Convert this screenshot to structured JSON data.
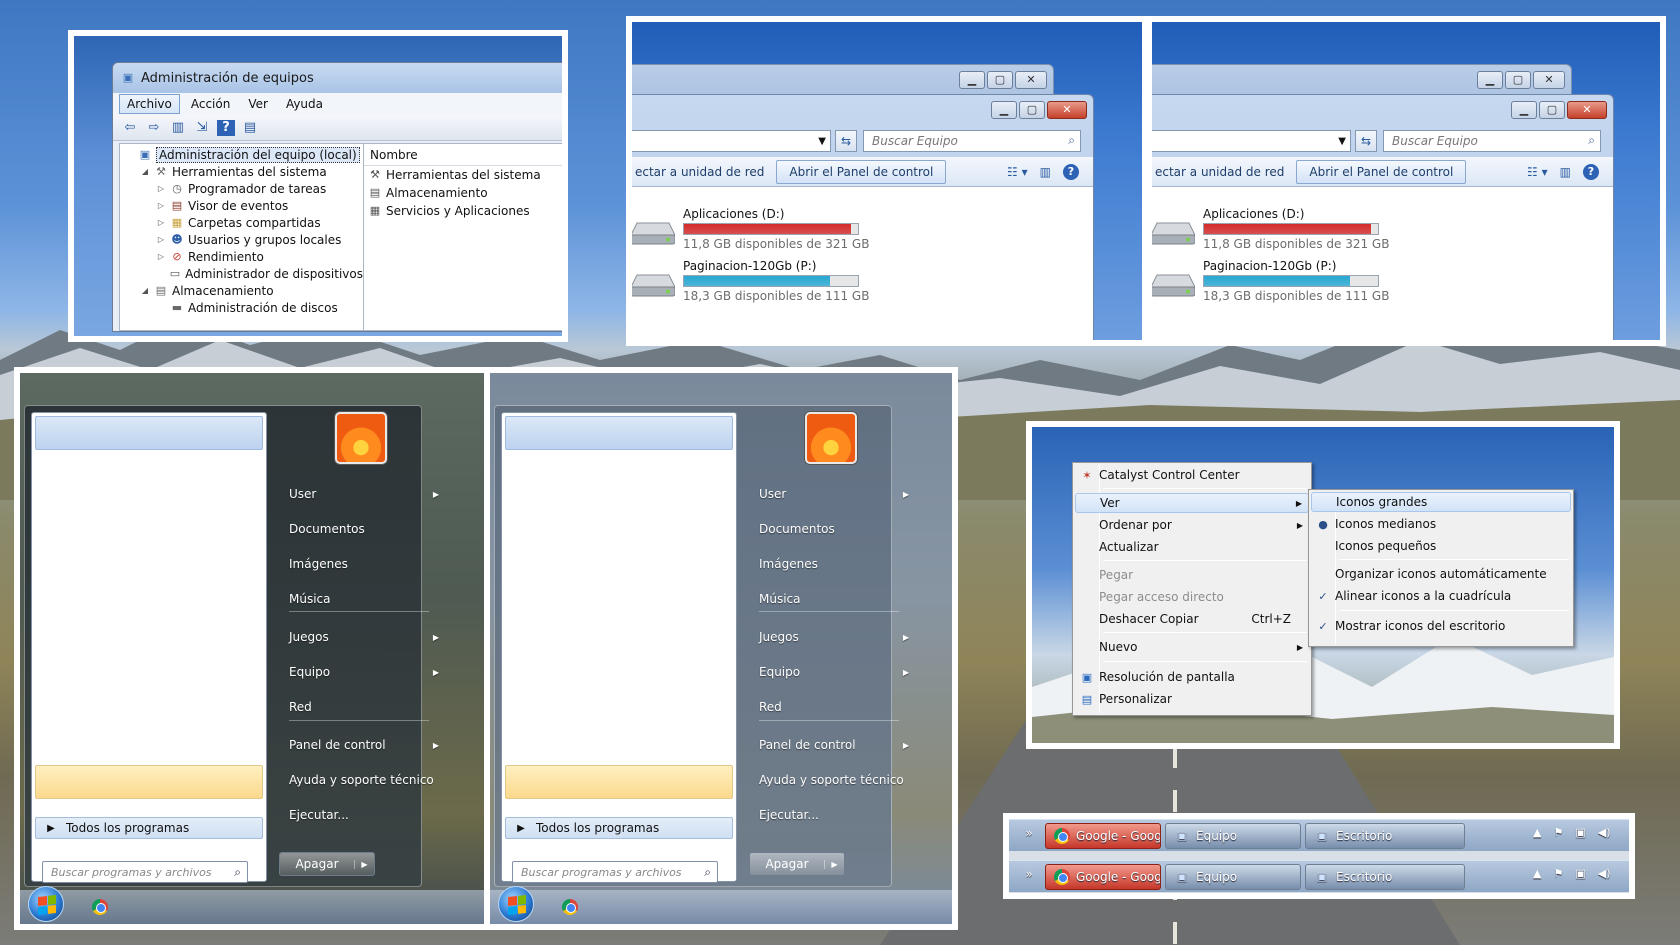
{
  "mmc": {
    "title": "Administración de equipos",
    "menu": [
      "Archivo",
      "Acción",
      "Ver",
      "Ayuda"
    ],
    "tree": [
      {
        "label": "Administración del equipo (local)",
        "level": 0,
        "expander": "",
        "icon": "computer-icon",
        "glyph": "▣",
        "color": "#3b6fb6",
        "selected": true
      },
      {
        "label": "Herramientas del sistema",
        "level": 1,
        "expander": "◢",
        "icon": "tools-icon",
        "glyph": "⚒",
        "color": "#6b6b6b"
      },
      {
        "label": "Programador de tareas",
        "level": 2,
        "expander": "▷",
        "icon": "clock-icon",
        "glyph": "◷",
        "color": "#5a5a5a"
      },
      {
        "label": "Visor de eventos",
        "level": 2,
        "expander": "▷",
        "icon": "event-viewer-icon",
        "glyph": "▤",
        "color": "#8a3a2a"
      },
      {
        "label": "Carpetas compartidas",
        "level": 2,
        "expander": "▷",
        "icon": "shared-folder-icon",
        "glyph": "▦",
        "color": "#c8a13b"
      },
      {
        "label": "Usuarios y grupos locales",
        "level": 2,
        "expander": "▷",
        "icon": "users-icon",
        "glyph": "☻",
        "color": "#2f5fa8"
      },
      {
        "label": "Rendimiento",
        "level": 2,
        "expander": "▷",
        "icon": "performance-icon",
        "glyph": "⊘",
        "color": "#c0392b"
      },
      {
        "label": "Administrador de dispositivos",
        "level": 2,
        "expander": "",
        "icon": "device-manager-icon",
        "glyph": "▭",
        "color": "#555555"
      },
      {
        "label": "Almacenamiento",
        "level": 1,
        "expander": "◢",
        "icon": "storage-icon",
        "glyph": "▤",
        "color": "#6a6a6a"
      },
      {
        "label": "Administración de discos",
        "level": 2,
        "expander": "",
        "icon": "disk-icon",
        "glyph": "▬",
        "color": "#6a6a6a"
      }
    ],
    "list_header": "Nombre",
    "list": [
      {
        "label": "Herramientas del sistema",
        "icon": "tools-icon",
        "glyph": "⚒"
      },
      {
        "label": "Almacenamiento",
        "icon": "storage-icon",
        "glyph": "▤"
      },
      {
        "label": "Servicios y Aplicaciones",
        "icon": "services-icon",
        "glyph": "▦"
      }
    ]
  },
  "explorer": {
    "search_placeholder": "Buscar Equipo",
    "cmd_map_drive": "ectar a unidad de red",
    "cmd_control_panel": "Abrir el Panel de control",
    "drives": [
      {
        "name": "Aplicaciones (D:)",
        "free": "11,8 GB disponibles de 321 GB",
        "used_fraction": 0.96,
        "bar_color": "#d42a2a"
      },
      {
        "name": "Paginacion-120Gb (P:)",
        "free": "18,3 GB disponibles de 111 GB",
        "used_fraction": 0.84,
        "bar_color": "#27a8d3"
      }
    ]
  },
  "start_menu": {
    "items": [
      {
        "label": "User",
        "has_sub": true
      },
      {
        "label": "Documentos",
        "has_sub": false
      },
      {
        "label": "Imágenes",
        "has_sub": false
      },
      {
        "label": "Música",
        "has_sub": false
      },
      {
        "label": "Juegos",
        "has_sub": true
      },
      {
        "label": "Equipo",
        "has_sub": true
      },
      {
        "label": "Red",
        "has_sub": false
      },
      {
        "label": "Panel de control",
        "has_sub": true
      },
      {
        "label": "Ayuda y soporte técnico",
        "has_sub": false
      },
      {
        "label": "Ejecutar...",
        "has_sub": false
      }
    ],
    "all_programs": "Todos los programas",
    "search_placeholder": "Buscar programas y archivos",
    "shutdown": "Apagar"
  },
  "context_menu": {
    "main": [
      {
        "label": "Catalyst Control Center",
        "icon": "catalyst-icon",
        "glyph": "✶",
        "shortcut": "",
        "sub": false,
        "disabled": false,
        "highlight": false
      },
      {
        "label": "Ver",
        "icon": "",
        "glyph": "",
        "shortcut": "",
        "sub": true,
        "disabled": false,
        "highlight": true
      },
      {
        "label": "Ordenar por",
        "icon": "",
        "glyph": "",
        "shortcut": "",
        "sub": true,
        "disabled": false,
        "highlight": false
      },
      {
        "label": "Actualizar",
        "icon": "",
        "glyph": "",
        "shortcut": "",
        "sub": false,
        "disabled": false,
        "highlight": false
      },
      {
        "label": "Pegar",
        "icon": "",
        "glyph": "",
        "shortcut": "",
        "sub": false,
        "disabled": true,
        "highlight": false
      },
      {
        "label": "Pegar acceso directo",
        "icon": "",
        "glyph": "",
        "shortcut": "",
        "sub": false,
        "disabled": true,
        "highlight": false
      },
      {
        "label": "Deshacer Copiar",
        "icon": "",
        "glyph": "",
        "shortcut": "Ctrl+Z",
        "sub": false,
        "disabled": false,
        "highlight": false
      },
      {
        "label": "Nuevo",
        "icon": "",
        "glyph": "",
        "shortcut": "",
        "sub": true,
        "disabled": false,
        "highlight": false
      },
      {
        "label": "Resolución de pantalla",
        "icon": "display-icon",
        "glyph": "▣",
        "shortcut": "",
        "sub": false,
        "disabled": false,
        "highlight": false
      },
      {
        "label": "Personalizar",
        "icon": "personalize-icon",
        "glyph": "▤",
        "shortcut": "",
        "sub": false,
        "disabled": false,
        "highlight": false
      }
    ],
    "submenu": [
      {
        "label": "Iconos grandes",
        "mark": "",
        "highlight": true
      },
      {
        "label": "Iconos medianos",
        "mark": "●",
        "highlight": false
      },
      {
        "label": "Iconos pequeños",
        "mark": "",
        "highlight": false
      },
      {
        "label": "Organizar iconos automáticamente",
        "mark": "",
        "highlight": false
      },
      {
        "label": "Alinear iconos a la cuadrícula",
        "mark": "✓",
        "highlight": false
      },
      {
        "label": "Mostrar iconos del escritorio",
        "mark": "✓",
        "highlight": false
      }
    ]
  },
  "taskbar": {
    "chevron": "»",
    "buttons": [
      {
        "label": "Google - Google Chr...",
        "icon": "chrome-icon",
        "active": true
      },
      {
        "label": "Equipo",
        "icon": "computer-icon",
        "active": false
      },
      {
        "label": "Escritorio",
        "icon": "desktop-icon",
        "active": false
      }
    ],
    "tray": [
      "▲",
      "⚑",
      "▣",
      "◀)"
    ]
  }
}
